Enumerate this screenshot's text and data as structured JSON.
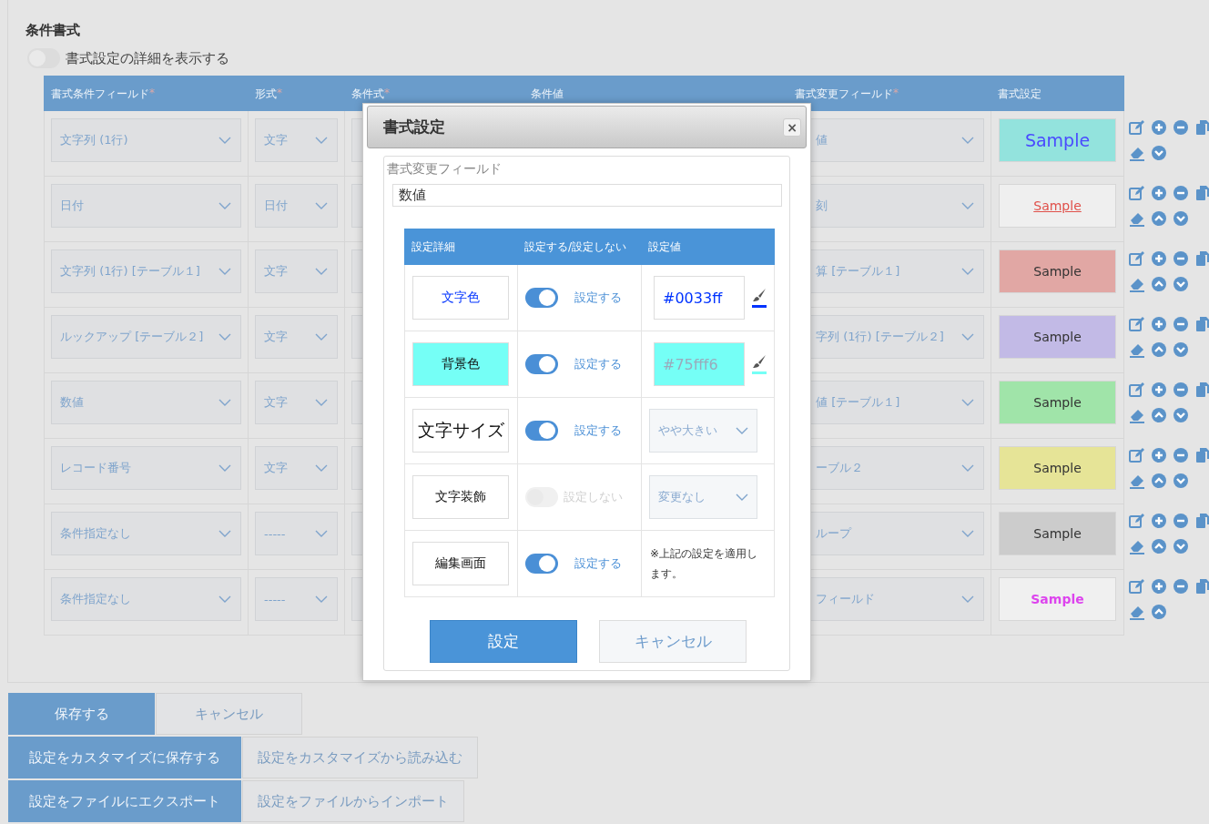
{
  "section": {
    "title": "条件書式",
    "details_toggle": {
      "label": "書式設定の詳細を表示する",
      "on": false
    }
  },
  "table": {
    "columns": [
      {
        "label": "書式条件フィールド",
        "required_mark": "*"
      },
      {
        "label": "形式",
        "required_mark": "*"
      },
      {
        "label": "条件式",
        "required_mark": "*"
      },
      {
        "label": "条件値"
      },
      {
        "label": "書式変更フィールド",
        "required_mark": "*"
      },
      {
        "label": "書式設定"
      }
    ],
    "rows": [
      {
        "condition_field": "文字列 (1行)",
        "format": "文字",
        "target_field": "値",
        "sample": {
          "text": "Sample",
          "color": "#93e3dd",
          "kind": "blue-large"
        },
        "can_move_up": false,
        "can_move_down": true
      },
      {
        "condition_field": "日付",
        "format": "日付",
        "target_field": "刻",
        "sample": {
          "text": "Sample",
          "color": "#efefef",
          "kind": "red-underline"
        },
        "can_move_up": true,
        "can_move_down": true
      },
      {
        "condition_field": "文字列 (1行) [テーブル１]",
        "format": "文字",
        "target_field": "算 [テーブル１]",
        "sample": {
          "text": "Sample",
          "color": "#e1a7a4",
          "kind": "plain"
        },
        "can_move_up": true,
        "can_move_down": true
      },
      {
        "condition_field": "ルックアップ [テーブル２]",
        "format": "文字",
        "target_field": "字列 (1行) [テーブル２]",
        "sample": {
          "text": "Sample",
          "color": "#c2bae6",
          "kind": "plain"
        },
        "can_move_up": true,
        "can_move_down": true
      },
      {
        "condition_field": "数値",
        "format": "文字",
        "target_field": "値 [テーブル１]",
        "sample": {
          "text": "Sample",
          "color": "#a0e4a9",
          "kind": "plain"
        },
        "can_move_up": true,
        "can_move_down": true
      },
      {
        "condition_field": "レコード番号",
        "format": "文字",
        "target_field": "ーブル２",
        "sample": {
          "text": "Sample",
          "color": "#e6e497",
          "kind": "plain"
        },
        "can_move_up": true,
        "can_move_down": true
      },
      {
        "condition_field": "条件指定なし",
        "format": "-----",
        "target_field": "ループ",
        "sample": {
          "text": "Sample",
          "color": "#cccccc",
          "kind": "plain"
        },
        "can_move_up": true,
        "can_move_down": true
      },
      {
        "condition_field": "条件指定なし",
        "format": "-----",
        "target_field": "フィールド",
        "sample": {
          "text": "Sample",
          "color": "#f0f0f0",
          "kind": "magenta-bold"
        },
        "can_move_up": true,
        "can_move_down": false
      }
    ]
  },
  "dialog": {
    "title": "書式設定",
    "close": "×",
    "field_label": "書式変更フィールド",
    "field_value": "数値",
    "columns": [
      "設定詳細",
      "設定する/設定しない",
      "設定値"
    ],
    "rows": [
      {
        "kind": "text-color",
        "label": "文字色",
        "color": "#0033ff",
        "on": true,
        "status": "設定する",
        "value": "#0033ff"
      },
      {
        "kind": "background-color",
        "label": "背景色",
        "color": "#75fff6",
        "on": true,
        "status": "設定する",
        "value": "#75fff6"
      },
      {
        "kind": "size",
        "label": "文字サイズ",
        "on": true,
        "status": "設定する",
        "value": "やや大きい"
      },
      {
        "kind": "decoration",
        "label": "文字装飾",
        "on": false,
        "status": "設定しない",
        "value": "変更なし"
      },
      {
        "kind": "note",
        "label": "編集画面",
        "on": true,
        "status": "設定する",
        "value": "※上記の設定を適用します。"
      }
    ],
    "buttons": [
      {
        "label": "設定",
        "kind": "primary"
      },
      {
        "label": "キャンセル",
        "kind": "secondary"
      }
    ]
  },
  "footer": {
    "button_rows": [
      [
        {
          "label": "保存する",
          "kind": "primary"
        },
        {
          "label": "キャンセル",
          "kind": "secondary"
        }
      ],
      [
        {
          "label": "設定をカスタマイズに保存する",
          "kind": "primary"
        },
        {
          "label": "設定をカスタマイズから読み込む",
          "kind": "secondary"
        }
      ],
      [
        {
          "label": "設定をファイルにエクスポート",
          "kind": "primary"
        },
        {
          "label": "設定をファイルからインポート",
          "kind": "secondary"
        }
      ]
    ]
  }
}
